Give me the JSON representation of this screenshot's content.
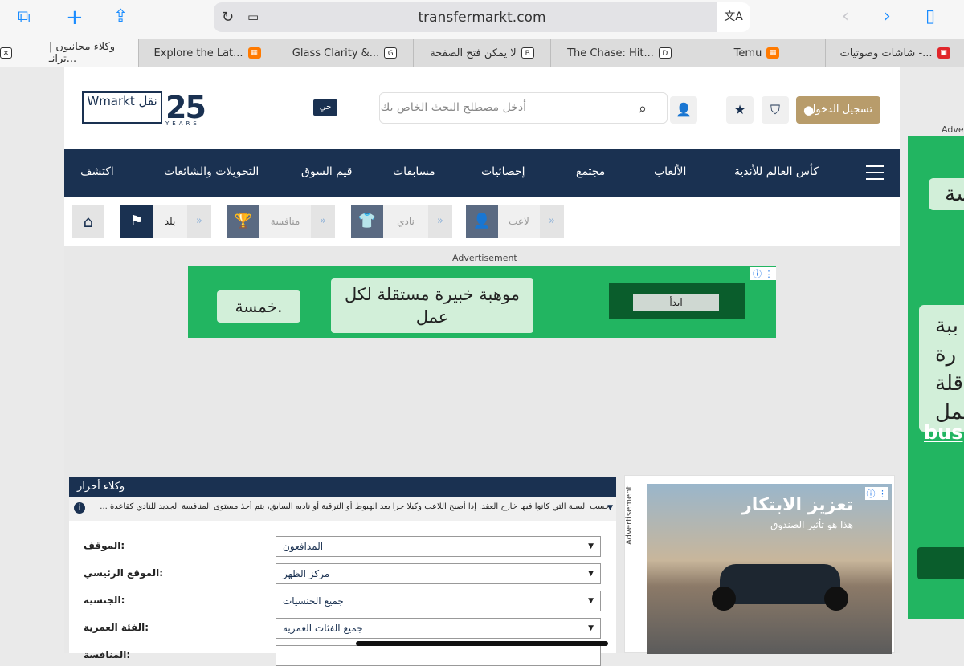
{
  "browser": {
    "url": "transfermarkt.com",
    "tabs": [
      {
        "title": "وكلاء مجانيون | ترانـ...",
        "favicon": "close-box",
        "active": true
      },
      {
        "title": "Explore the Lat...",
        "favicon": "temu"
      },
      {
        "title": "Glass Clarity &...",
        "favicon": "G"
      },
      {
        "title": "لا يمكن فتح الصفحة",
        "favicon": "B"
      },
      {
        "title": "The Chase: Hit...",
        "favicon": "D"
      },
      {
        "title": "Temu",
        "favicon": "temu"
      },
      {
        "title": "شاشات وصوتيات -...",
        "favicon": "red"
      }
    ]
  },
  "header": {
    "logo_text": "Wmarkt نقل",
    "logo_25": "25",
    "logo_years": "YEARS",
    "live_badge": "حي",
    "search_placeholder": "أدخل مصطلح البحث الخاص بك",
    "login_label": "تسجيل الدخول"
  },
  "nav": {
    "items": [
      "اكتشف",
      "التحويلات والشائعات",
      "قيم السوق",
      "مسابقات",
      "إحصائيات",
      "مجتمع",
      "الألعاب",
      "كأس العالم للأندية"
    ]
  },
  "quick_search": {
    "country": "بلد",
    "competition": "منافسة",
    "club": "نادي",
    "player": "لاعب"
  },
  "ad_banner": {
    "label": "Advertisement",
    "left_text": "خمسة.",
    "middle_text": "موهبة خبيرة مستقلة لكل عمل",
    "cta": "ابدأ"
  },
  "panel": {
    "title": "وكلاء أحرار",
    "note": "حسب السنة التي كانوا فيها خارج العقد. إذا أصبح اللاعب وكيلا حرا بعد الهبوط أو الترقية أو ناديه السابق، يتم أخذ مستوى المنافسة الجديد للنادي كقاعدة ...",
    "fields": [
      {
        "label": "الموقف:",
        "value": "المدافعون"
      },
      {
        "label": "الموقع الرئيسي:",
        "value": "مركز الظهر"
      },
      {
        "label": "الجنسية:",
        "value": "جميع الجنسيات"
      },
      {
        "label": "الفئة العمرية:",
        "value": "جميع الفئات العمرية"
      },
      {
        "label": "المنافسة:",
        "value": ""
      }
    ]
  },
  "side_ad": {
    "label": "Advertisement",
    "title": "تعزيز الابتكار",
    "subtitle": "هذا هو تأثير الصندوق"
  },
  "right_ad": {
    "label": "Adver",
    "box1": "سة",
    "box2_lines": [
      "ببة",
      "رة",
      "قلة",
      "عمل"
    ],
    "link": "bus"
  },
  "colors": {
    "navy": "#1a3151",
    "ad_green": "#22b561",
    "gold": "#b89c6b",
    "safari_blue": "#1a8cff"
  }
}
